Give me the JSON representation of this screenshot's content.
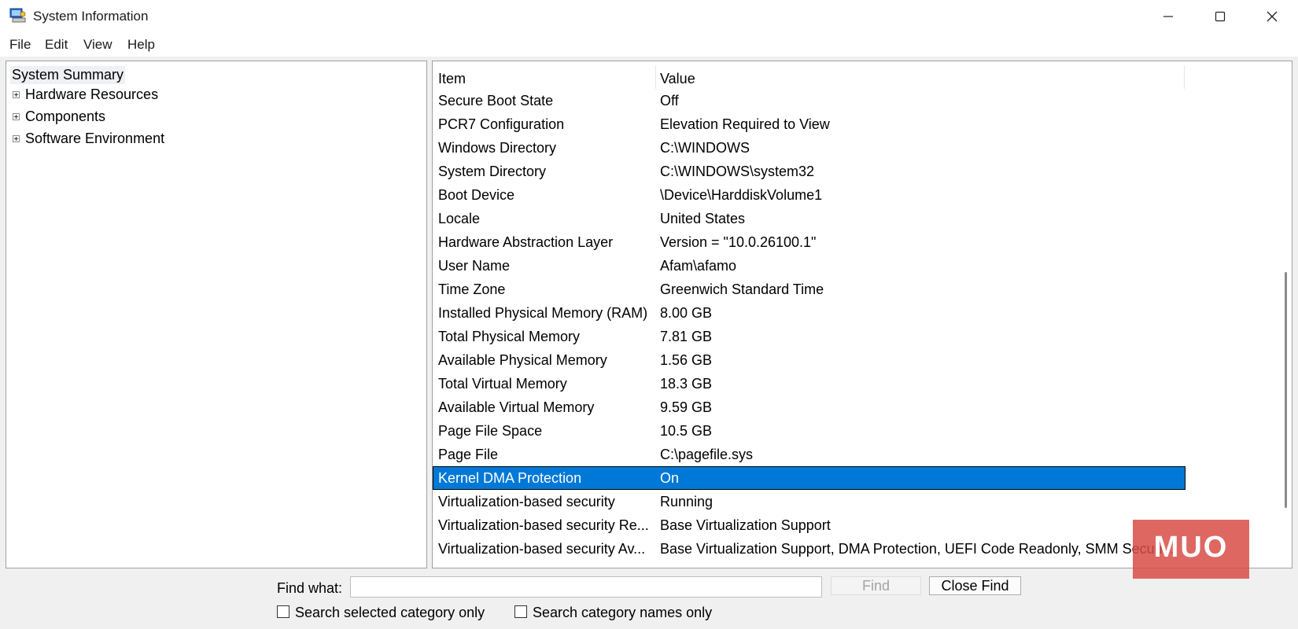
{
  "window": {
    "title": "System Information"
  },
  "menu": [
    "File",
    "Edit",
    "View",
    "Help"
  ],
  "tree": [
    {
      "label": "System Summary",
      "expandable": false,
      "selected": true
    },
    {
      "label": "Hardware Resources",
      "expandable": true
    },
    {
      "label": "Components",
      "expandable": true
    },
    {
      "label": "Software Environment",
      "expandable": true
    }
  ],
  "table": {
    "headers": {
      "item": "Item",
      "value": "Value"
    },
    "rows": [
      {
        "item": "Secure Boot State",
        "value": "Off"
      },
      {
        "item": "PCR7 Configuration",
        "value": "Elevation Required to View"
      },
      {
        "item": "Windows Directory",
        "value": "C:\\WINDOWS"
      },
      {
        "item": "System Directory",
        "value": "C:\\WINDOWS\\system32"
      },
      {
        "item": "Boot Device",
        "value": "\\Device\\HarddiskVolume1"
      },
      {
        "item": "Locale",
        "value": "United States"
      },
      {
        "item": "Hardware Abstraction Layer",
        "value": "Version = \"10.0.26100.1\""
      },
      {
        "item": "User Name",
        "value": "Afam\\afamo"
      },
      {
        "item": "Time Zone",
        "value": "Greenwich Standard Time"
      },
      {
        "item": "Installed Physical Memory (RAM)",
        "value": "8.00 GB"
      },
      {
        "item": "Total Physical Memory",
        "value": "7.81 GB"
      },
      {
        "item": "Available Physical Memory",
        "value": "1.56 GB"
      },
      {
        "item": "Total Virtual Memory",
        "value": "18.3 GB"
      },
      {
        "item": "Available Virtual Memory",
        "value": "9.59 GB"
      },
      {
        "item": "Page File Space",
        "value": "10.5 GB"
      },
      {
        "item": "Page File",
        "value": "C:\\pagefile.sys"
      },
      {
        "item": "Kernel DMA Protection",
        "value": "On",
        "selected": true
      },
      {
        "item": "Virtualization-based security",
        "value": "Running"
      },
      {
        "item": "Virtualization-based security Re...",
        "value": "Base Virtualization Support"
      },
      {
        "item": "Virtualization-based security Av...",
        "value": "Base Virtualization Support, DMA Protection, UEFI Code Readonly, SMM Securi..."
      }
    ]
  },
  "find": {
    "label": "Find what:",
    "value": "",
    "find_button": "Find",
    "close_button": "Close Find",
    "check_selected": "Search selected category only",
    "check_names": "Search category names only"
  },
  "watermark": "MUO",
  "colors": {
    "selection": "#0078d7",
    "watermark": "#d84c46"
  }
}
